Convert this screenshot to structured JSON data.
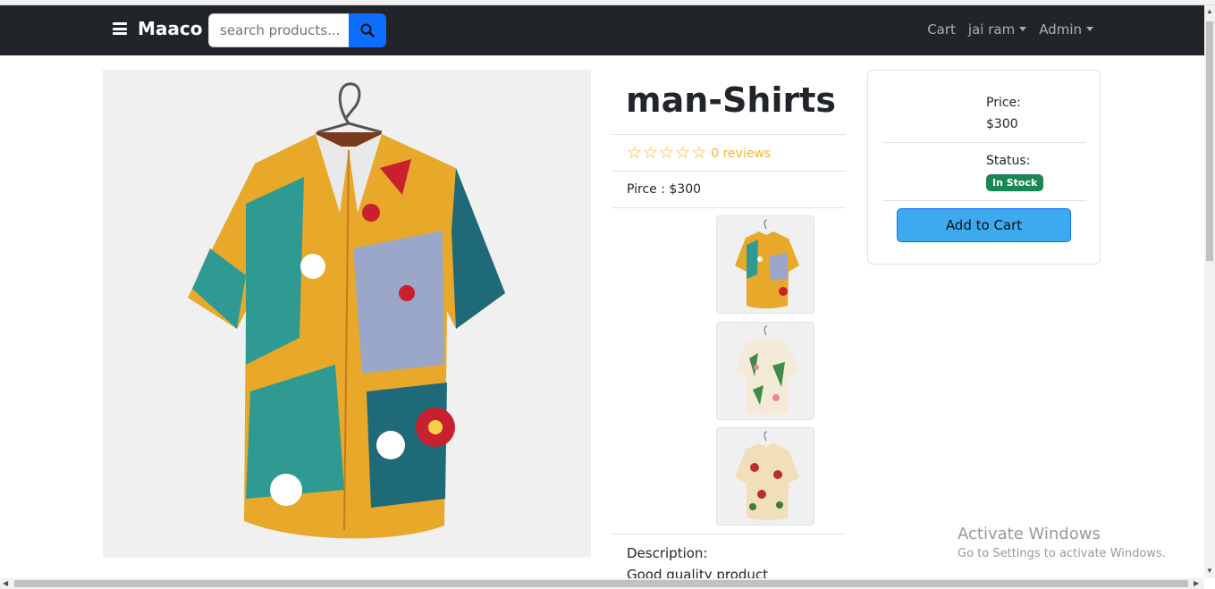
{
  "navbar": {
    "brand": "Maaco",
    "search_placeholder": "search products...",
    "links": {
      "cart": "Cart",
      "user": "jai ram",
      "admin": "Admin"
    }
  },
  "product": {
    "title": "man-Shirts",
    "rating_stars": 0,
    "reviews": "0 reviews",
    "price_line": "Pirce : $300",
    "description_label": "Description:",
    "description": "Good quality product"
  },
  "card": {
    "price_label": "Price:",
    "price": "$300",
    "status_label": "Status:",
    "status": "In Stock",
    "add_to_cart": "Add to Cart"
  },
  "watermark": {
    "line1": "Activate Windows",
    "line2": "Go to Settings to activate Windows."
  },
  "colors": {
    "navbar": "#212529",
    "primary": "#0d6efd",
    "success": "#198754",
    "star": "#f8b623"
  },
  "icons": [
    "hamburger-icon",
    "search-icon",
    "star-outline-icon",
    "chevron-down-icon"
  ]
}
